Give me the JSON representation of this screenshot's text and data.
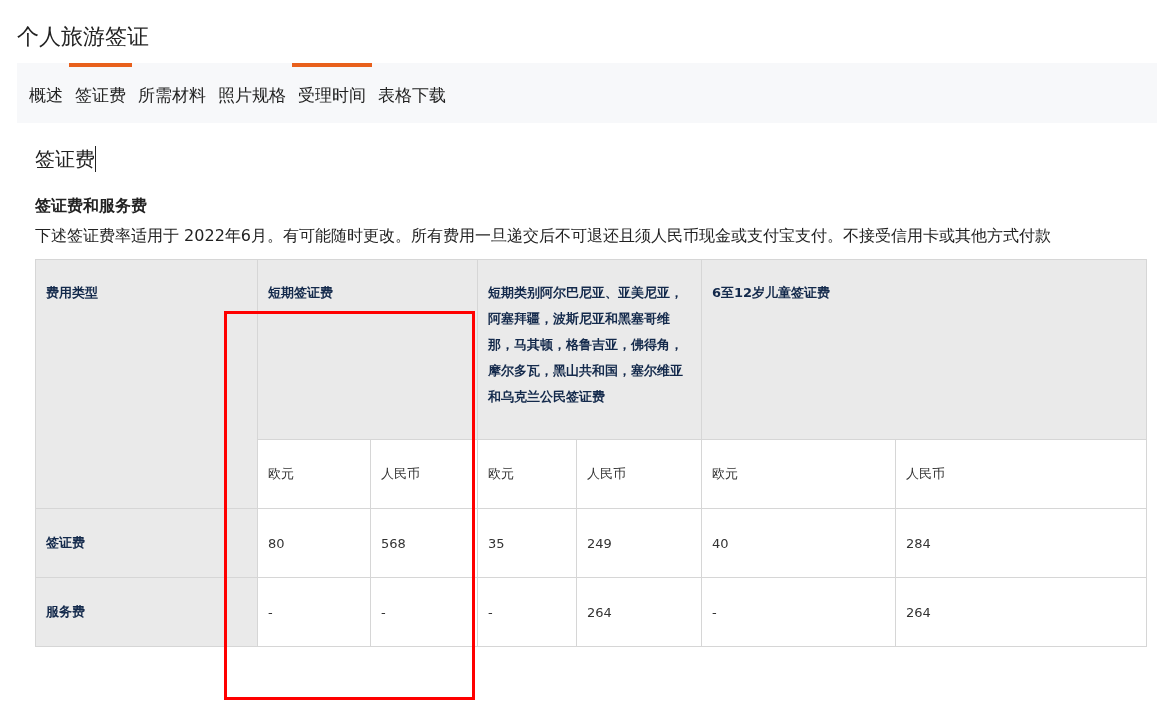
{
  "page_title": "个人旅游签证",
  "tabs": [
    {
      "label": "概述",
      "selected": false
    },
    {
      "label": "签证费",
      "selected": true
    },
    {
      "label": "所需材料",
      "selected": false
    },
    {
      "label": "照片规格",
      "selected": false
    },
    {
      "label": "受理时间",
      "selected": true
    },
    {
      "label": "表格下载",
      "selected": false
    }
  ],
  "section_title": "签证费",
  "subsection_title": "签证费和服务费",
  "note": "下述签证费率适用于 2022年6月。有可能随时更改。所有费用一旦递交后不可退还且须人民币现金或支付宝支付。不接受信用卡或其他方式付款",
  "table": {
    "corner_header": "费用类型",
    "groups": [
      {
        "label": "短期签证费",
        "subcolumns": [
          "欧元",
          "人民币"
        ]
      },
      {
        "label": "短期类别阿尔巴尼亚、亚美尼亚，阿塞拜疆，波斯尼亚和黑塞哥维那，马其顿，格鲁吉亚，佛得角，摩尔多瓦，黑山共和国，塞尔维亚和乌克兰公民签证费",
        "subcolumns": [
          "欧元",
          "人民币"
        ]
      },
      {
        "label": "6至12岁儿童签证费",
        "subcolumns": [
          "欧元",
          "人民币"
        ]
      }
    ],
    "rows": [
      {
        "label": "签证费",
        "cells": [
          "80",
          "568",
          "35",
          "249",
          "40",
          "284"
        ]
      },
      {
        "label": "服务费",
        "cells": [
          "-",
          "-",
          "-",
          "264",
          "-",
          "264"
        ]
      }
    ]
  }
}
